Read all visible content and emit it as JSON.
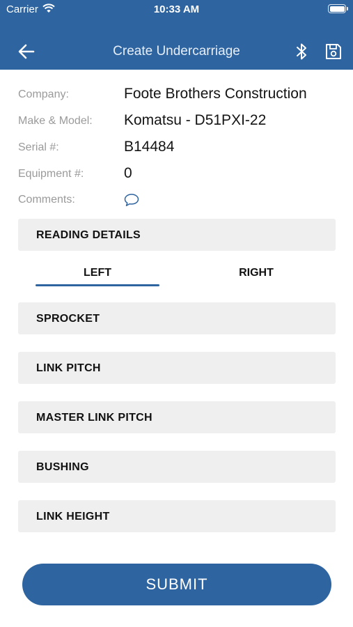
{
  "status_bar": {
    "carrier": "Carrier",
    "time": "10:33 AM"
  },
  "nav": {
    "title": "Create Undercarriage"
  },
  "info": [
    {
      "label": "Company:",
      "value": "Foote Brothers Construction"
    },
    {
      "label": "Make & Model:",
      "value": "Komatsu - D51PXI-22"
    },
    {
      "label": "Serial #:",
      "value": "B14484"
    },
    {
      "label": "Equipment #:",
      "value": "0"
    },
    {
      "label": "Comments:",
      "icon": "speech-bubble-icon"
    }
  ],
  "reading_details": {
    "label": "READING DETAILS"
  },
  "tabs": [
    {
      "label": "LEFT",
      "active": true
    },
    {
      "label": "RIGHT",
      "active": false
    }
  ],
  "sections": [
    {
      "label": "SPROCKET"
    },
    {
      "label": "LINK PITCH"
    },
    {
      "label": "MASTER LINK PITCH"
    },
    {
      "label": "BUSHING"
    },
    {
      "label": "LINK HEIGHT"
    }
  ],
  "submit": {
    "label": "SUBMIT"
  },
  "colors": {
    "primary": "#2e64a0",
    "section_bg": "#efefef",
    "label_gray": "#9a9a9a"
  }
}
